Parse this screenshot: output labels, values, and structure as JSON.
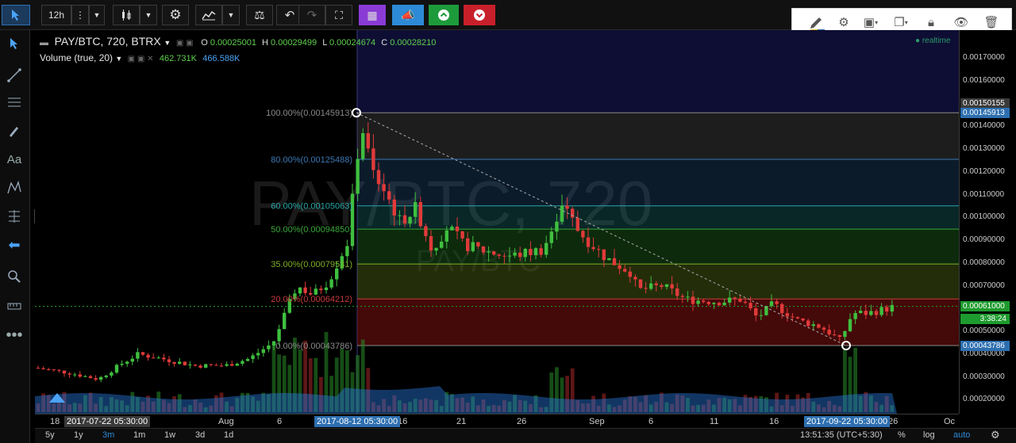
{
  "toolbar": {
    "interval": "12h",
    "more_icon": "vertical-dots-icon",
    "candle_icon": "candlestick-icon",
    "settings_icon": "gear-icon",
    "indicators_icon": "indicators-icon",
    "compare_icon": "scales-icon",
    "undo_icon": "undo-icon",
    "redo_icon": "redo-icon",
    "fullscreen_icon": "fullscreen-icon",
    "purple_icon": "cube-icon",
    "blue_icon": "megaphone-icon",
    "green_icon": "arrow-up-icon",
    "red_icon": "arrow-down-icon"
  },
  "drawbar": {
    "tools": [
      "pencil-icon",
      "gear-icon",
      "layers-icon",
      "clone-icon",
      "lock-icon",
      "eye-icon",
      "trash-icon"
    ]
  },
  "sidebar": {
    "tools": [
      "cursor-icon",
      "trendline-icon",
      "horizontal-lines-icon",
      "brush-icon",
      "text-icon",
      "pattern-icon",
      "fib-icon",
      "arrow-left-icon",
      "zoom-icon",
      "measure-icon",
      "more-icon"
    ],
    "text_tool_label": "Aa"
  },
  "legend": {
    "symbol": "PAY/BTC, 720, BTRX",
    "o_label": "O",
    "o_value": "0.00025001",
    "h_label": "H",
    "h_value": "0.00029499",
    "l_label": "L",
    "l_value": "0.00024674",
    "c_label": "C",
    "c_value": "0.00028210"
  },
  "volume_legend": {
    "label": "Volume (true, 20)",
    "value1": "462.731K",
    "value2": "466.588K"
  },
  "realtime_label": "realtime",
  "watermark": {
    "symbol": "PAY/BTC, 720",
    "sub": "PAY/BTC"
  },
  "fib_levels": [
    {
      "label": "100.00%(0.00145913)",
      "color": "#8a8a8a"
    },
    {
      "label": "80.00%(0.00125488)",
      "color": "#3c78b4"
    },
    {
      "label": "60.00%(0.00105063)",
      "color": "#2aa6a6"
    },
    {
      "label": "50.00%(0.00094850)",
      "color": "#3aa83a"
    },
    {
      "label": "35.00%(0.00079531)",
      "color": "#7fae23"
    },
    {
      "label": "20.00%(0.00064212)",
      "color": "#c83c3c"
    },
    {
      "label": "0.00%(0.00043786)",
      "color": "#8a8a8a"
    }
  ],
  "price_axis": {
    "labels": [
      "0.00170000",
      "0.00160000",
      "0.00140000",
      "0.00130000",
      "0.00120000",
      "0.00110000",
      "0.00100000",
      "0.00090000",
      "0.00080000",
      "0.00070000",
      "0.00050000",
      "0.00040000",
      "0.00030000",
      "0.00020000"
    ],
    "tag_high": "0.00150155",
    "tag_fib100": "0.00145913",
    "tag_price": "0.00061000",
    "tag_countdown": "3:38:24",
    "tag_fib0": "0.00043786"
  },
  "time_axis": {
    "labels": [
      "18",
      "Aug",
      "6",
      "16",
      "21",
      "26",
      "Sep",
      "6",
      "11",
      "16",
      "26",
      "Oc"
    ],
    "tag_left": "2017-07-22 05:30:00",
    "tag_mid": "2017-08-12 05:30:00",
    "tag_right": "2017-09-22 05:30:00"
  },
  "bottom": {
    "ranges": [
      "5y",
      "1y",
      "3m",
      "1m",
      "1w",
      "3d",
      "1d"
    ],
    "active_range": "3m",
    "clock": "13:51:35 (UTC+5:30)",
    "percent": "%",
    "log": "log",
    "auto": "auto",
    "settings_icon": "gear-icon"
  },
  "colors": {
    "up": "#3fbf3f",
    "down": "#e03a3a",
    "accent": "#2d8ad6",
    "price_tag": "#1e9b2e",
    "fib_tag": "#2d6fb0"
  },
  "chart_data": {
    "type": "candlestick",
    "ylim": [
      0.00015,
      0.0018
    ],
    "x_range": [
      "2017-07-15",
      "2017-09-30"
    ],
    "fib_anchor_high": {
      "date": "2017-08-12",
      "price": 0.00145913
    },
    "fib_anchor_low": {
      "date": "2017-09-22",
      "price": 0.00043786
    },
    "last_price": 0.00061
  }
}
